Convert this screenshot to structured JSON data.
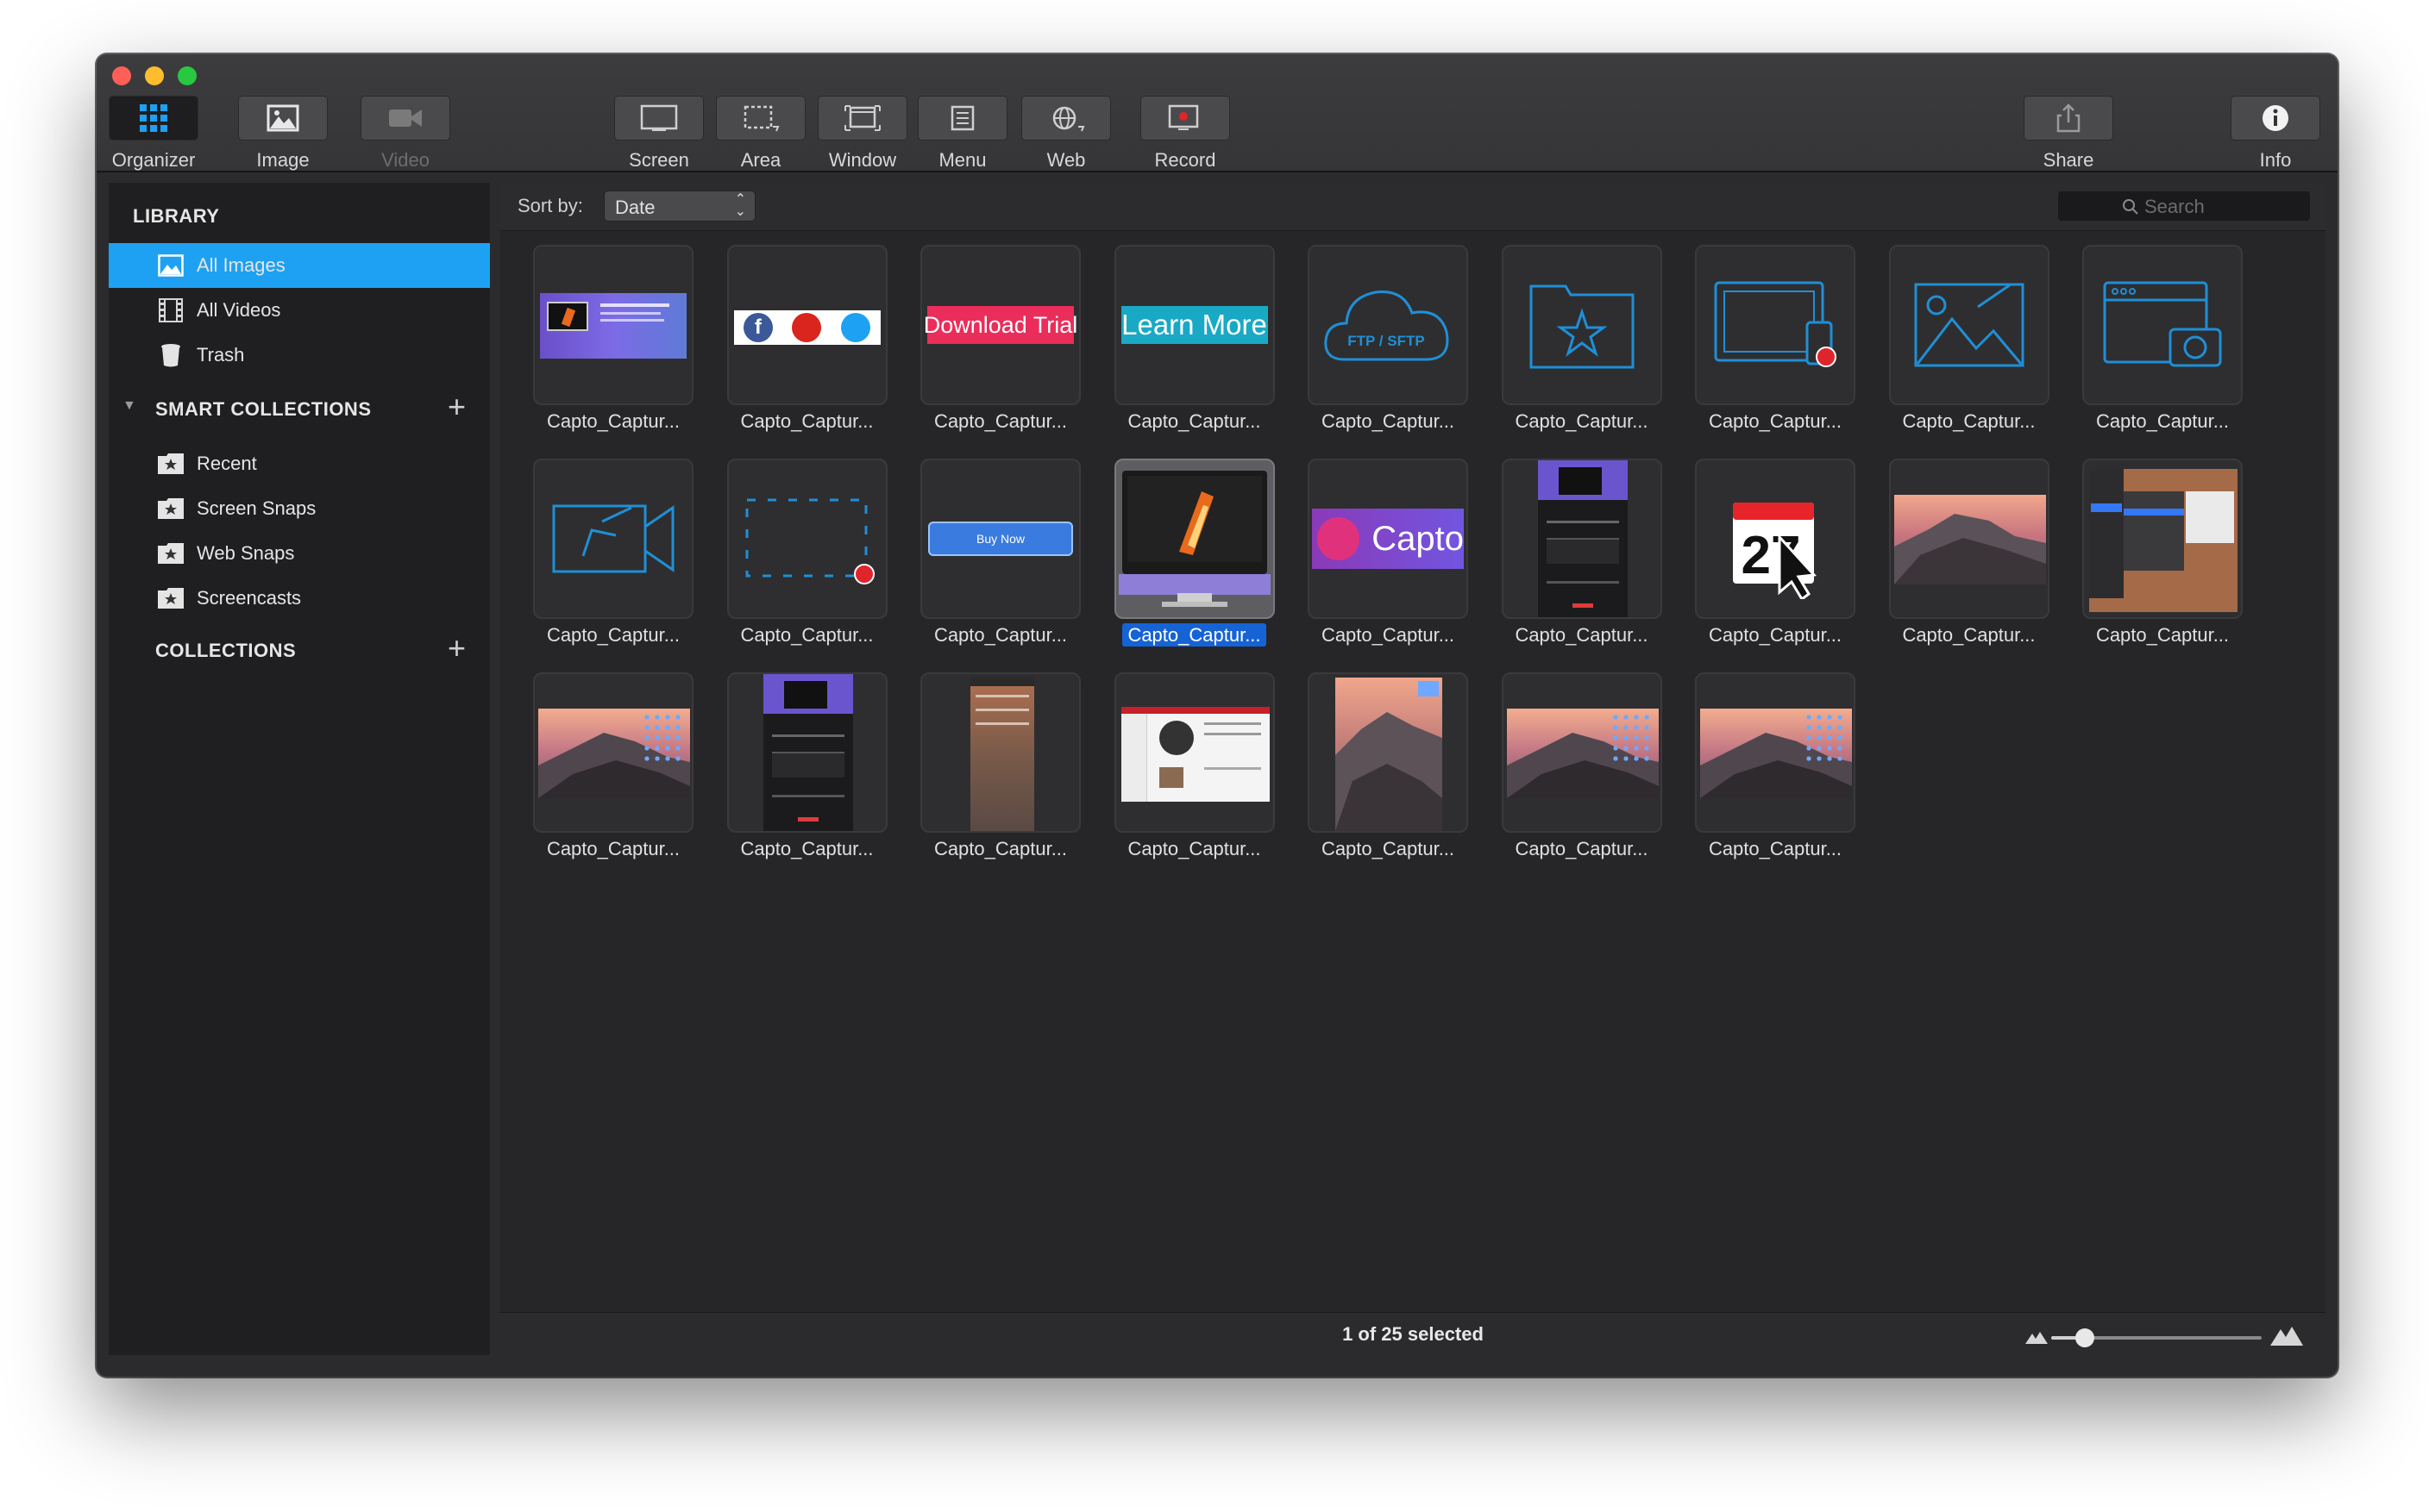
{
  "toolbar": {
    "left": [
      {
        "label": "Organizer",
        "icon": "grid-icon",
        "state": "active"
      },
      {
        "label": "Image",
        "icon": "image-icon",
        "state": "normal"
      },
      {
        "label": "Video",
        "icon": "video-camera-icon",
        "state": "disabled"
      }
    ],
    "capture": [
      {
        "label": "Screen",
        "icon": "screen-icon"
      },
      {
        "label": "Area",
        "icon": "area-selection-icon"
      },
      {
        "label": "Window",
        "icon": "window-icon"
      },
      {
        "label": "Menu",
        "icon": "menu-icon"
      },
      {
        "label": "Web",
        "icon": "globe-icon"
      },
      {
        "label": "Record",
        "icon": "record-icon"
      }
    ],
    "right": [
      {
        "label": "Share",
        "icon": "share-icon"
      },
      {
        "label": "Info",
        "icon": "info-icon"
      }
    ]
  },
  "sidebar": {
    "library_header": "LIBRARY",
    "library_items": [
      {
        "label": "All Images",
        "icon": "image-icon",
        "selected": true
      },
      {
        "label": "All Videos",
        "icon": "film-icon",
        "selected": false
      },
      {
        "label": "Trash",
        "icon": "trash-icon",
        "selected": false
      }
    ],
    "smart_header": "SMART COLLECTIONS",
    "smart_items": [
      {
        "label": "Recent",
        "icon": "star-folder-icon"
      },
      {
        "label": "Screen Snaps",
        "icon": "star-folder-icon"
      },
      {
        "label": "Web Snaps",
        "icon": "star-folder-icon"
      },
      {
        "label": "Screencasts",
        "icon": "star-folder-icon"
      }
    ],
    "collections_header": "COLLECTIONS",
    "add_symbol": "+"
  },
  "sortbar": {
    "label": "Sort by:",
    "value": "Date",
    "search_placeholder": "Search"
  },
  "thumbnails": {
    "caption": "Capto_Captur...",
    "items": [
      {
        "kind": "web-purple"
      },
      {
        "kind": "social"
      },
      {
        "kind": "download-trial",
        "text": "Download Trial"
      },
      {
        "kind": "learn-more",
        "text": "Learn More"
      },
      {
        "kind": "cloud",
        "text": "FTP / SFTP"
      },
      {
        "kind": "star-folder"
      },
      {
        "kind": "tablet-record"
      },
      {
        "kind": "image-outline"
      },
      {
        "kind": "window-camera"
      },
      {
        "kind": "video-outline"
      },
      {
        "kind": "dashed-record"
      },
      {
        "kind": "buy-now",
        "text": "Buy Now"
      },
      {
        "kind": "imac",
        "selected": true
      },
      {
        "kind": "capto-logo",
        "text": "Capto"
      },
      {
        "kind": "web-long"
      },
      {
        "kind": "calendar",
        "text": "27"
      },
      {
        "kind": "mountain"
      },
      {
        "kind": "menu-shot"
      },
      {
        "kind": "desktop"
      },
      {
        "kind": "web-long"
      },
      {
        "kind": "phone-blur"
      },
      {
        "kind": "web-white"
      },
      {
        "kind": "mountain-tall"
      },
      {
        "kind": "desktop"
      },
      {
        "kind": "desktop"
      }
    ]
  },
  "footer": {
    "status": "1 of 25 selected",
    "zoom_fraction": 0.16
  },
  "colors": {
    "accent": "#1ea1f2",
    "selection": "#1663d6",
    "outline_blue": "#1f8fd6",
    "record_red": "#e0242b"
  }
}
